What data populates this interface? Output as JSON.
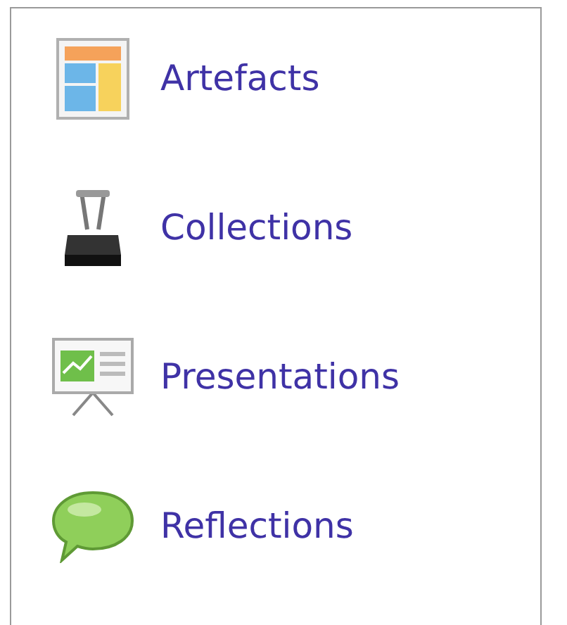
{
  "items": [
    {
      "label": "Artefacts"
    },
    {
      "label": "Collections"
    },
    {
      "label": "Presentations"
    },
    {
      "label": "Reflections"
    }
  ]
}
